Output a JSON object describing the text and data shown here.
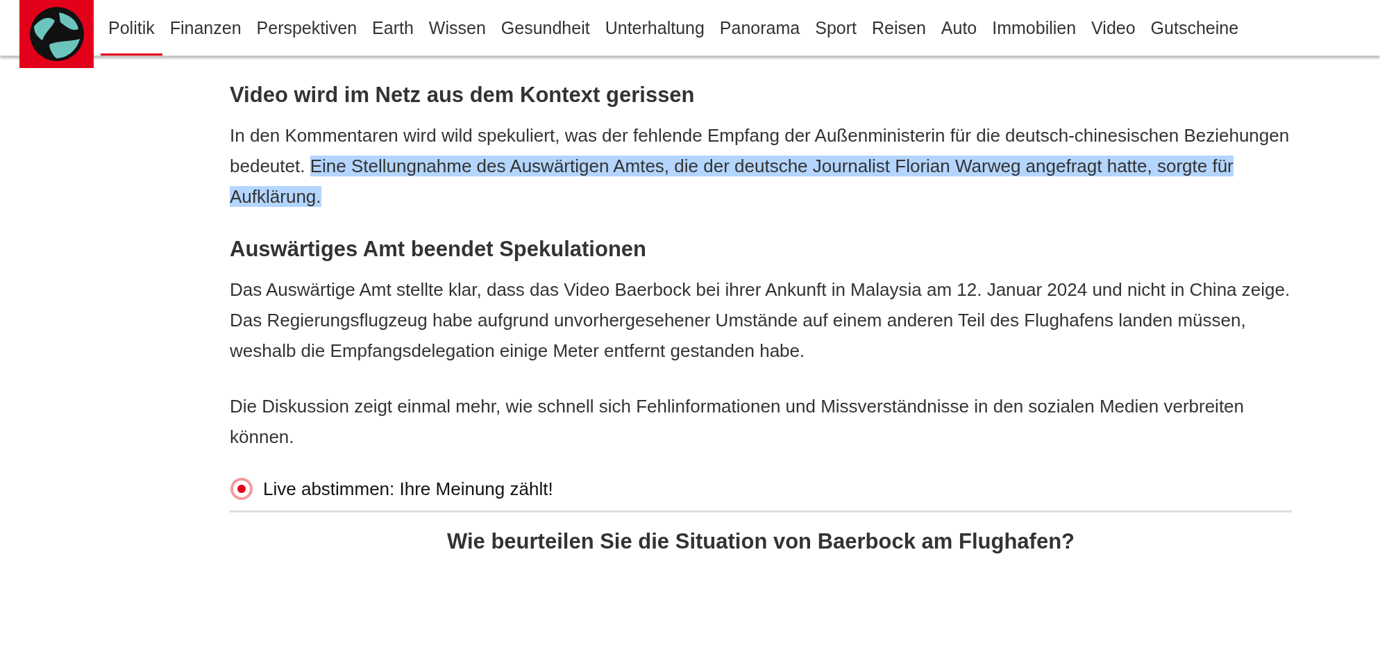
{
  "nav": {
    "items": [
      {
        "label": "Politik",
        "selected": true
      },
      {
        "label": "Finanzen",
        "selected": false
      },
      {
        "label": "Perspektiven",
        "selected": false
      },
      {
        "label": "Earth",
        "selected": false
      },
      {
        "label": "Wissen",
        "selected": false
      },
      {
        "label": "Gesundheit",
        "selected": false
      },
      {
        "label": "Unterhaltung",
        "selected": false
      },
      {
        "label": "Panorama",
        "selected": false
      },
      {
        "label": "Sport",
        "selected": false
      },
      {
        "label": "Reisen",
        "selected": false
      },
      {
        "label": "Auto",
        "selected": false
      },
      {
        "label": "Immobilien",
        "selected": false
      },
      {
        "label": "Video",
        "selected": false
      },
      {
        "label": "Gutscheine",
        "selected": false
      }
    ]
  },
  "article": {
    "blocks": [
      {
        "kind": "heading",
        "text": "Video wird im Netz aus dem Kontext gerissen"
      },
      {
        "kind": "paragraph",
        "segments": [
          {
            "text": "In den Kommentaren wird wild spekuliert, was der fehlende Empfang der Außenministerin für die deutsch-chinesischen Beziehungen bedeutet. ",
            "highlighted": false
          },
          {
            "text": "Eine Stellungnahme des Auswärtigen Amtes, die der deutsche Journalist Florian Warweg angefragt hatte, sorgte für Aufklärung.",
            "highlighted": true
          }
        ]
      },
      {
        "kind": "heading",
        "text": "Auswärtiges Amt beendet Spekulationen"
      },
      {
        "kind": "paragraph",
        "segments": [
          {
            "text": "Das Auswärtige Amt stellte klar, dass das Video Baerbock bei ihrer Ankunft in Malaysia am 12. Januar 2024 und nicht in China zeige. Das Regierungsflugzeug habe aufgrund unvorhergesehener Umstände auf einem anderen Teil des Flughafens landen müssen, weshalb die Empfangsdelegation einige Meter entfernt gestanden habe.",
            "highlighted": false
          }
        ]
      },
      {
        "kind": "paragraph",
        "segments": [
          {
            "text": "Die Diskussion zeigt einmal mehr, wie schnell sich Fehlinformationen und Missverständnisse in den sozialen Medien verbreiten können.",
            "highlighted": false
          }
        ]
      }
    ]
  },
  "poll": {
    "label": "Live abstimmen: Ihre Meinung zählt!",
    "question": "Wie beurteilen Sie die Situation von Baerbock am Flughafen?"
  }
}
